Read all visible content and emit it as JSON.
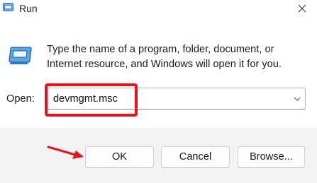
{
  "window": {
    "title": "Run",
    "title_icon": "run-dialog-icon",
    "close_icon": "close-icon"
  },
  "dialog": {
    "icon": "run-dialog-icon",
    "description_line1": "Type the name of a program, folder, document, or",
    "description_line2": "Internet resource, and Windows will open it for you.",
    "open_label": "Open:",
    "open_value": "devmgmt.msc",
    "dropdown_icon": "chevron-down-icon"
  },
  "buttons": {
    "ok": "OK",
    "cancel": "Cancel",
    "browse": "Browse..."
  },
  "annotation": {
    "highlight_color": "#e8131e",
    "arrow_color": "#e8131e"
  }
}
